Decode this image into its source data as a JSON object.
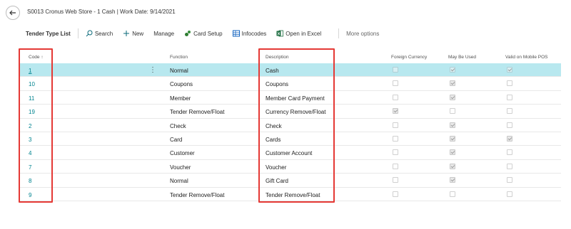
{
  "window": {
    "title": "S0013 Cronus Web Store - 1 Cash | Work Date: 9/14/2021"
  },
  "actionbar": {
    "page_name": "Tender Type List",
    "search": "Search",
    "new": "New",
    "manage": "Manage",
    "card_setup": "Card Setup",
    "infocodes": "Infocodes",
    "open_in_excel": "Open in Excel",
    "more_options": "More options"
  },
  "columns": {
    "code": "Code",
    "function": "Function",
    "description": "Description",
    "foreign_currency": "Foreign Currency",
    "may_be_used": "May Be Used",
    "valid_on_mobile_pos": "Valid on Mobile POS"
  },
  "rows": [
    {
      "code": "1",
      "function": "Normal",
      "description": "Cash",
      "foreign_currency": false,
      "may_be_used": true,
      "valid_mobile": true
    },
    {
      "code": "10",
      "function": "Coupons",
      "description": "Coupons",
      "foreign_currency": false,
      "may_be_used": true,
      "valid_mobile": false
    },
    {
      "code": "11",
      "function": "Member",
      "description": "Member Card Payment",
      "foreign_currency": false,
      "may_be_used": true,
      "valid_mobile": false
    },
    {
      "code": "19",
      "function": "Tender Remove/Float",
      "description": "Currency Remove/Float",
      "foreign_currency": true,
      "may_be_used": false,
      "valid_mobile": false
    },
    {
      "code": "2",
      "function": "Check",
      "description": "Check",
      "foreign_currency": false,
      "may_be_used": true,
      "valid_mobile": false
    },
    {
      "code": "3",
      "function": "Card",
      "description": "Cards",
      "foreign_currency": false,
      "may_be_used": true,
      "valid_mobile": true
    },
    {
      "code": "4",
      "function": "Customer",
      "description": "Customer Account",
      "foreign_currency": false,
      "may_be_used": true,
      "valid_mobile": false
    },
    {
      "code": "7",
      "function": "Voucher",
      "description": "Voucher",
      "foreign_currency": false,
      "may_be_used": true,
      "valid_mobile": false
    },
    {
      "code": "8",
      "function": "Normal",
      "description": "Gift Card",
      "foreign_currency": false,
      "may_be_used": true,
      "valid_mobile": false
    },
    {
      "code": "9",
      "function": "Tender Remove/Float",
      "description": "Tender Remove/Float",
      "foreign_currency": false,
      "may_be_used": false,
      "valid_mobile": false
    }
  ],
  "colors": {
    "link": "#00838f",
    "selected_row": "#b8e8ef",
    "highlight": "#e53935"
  }
}
